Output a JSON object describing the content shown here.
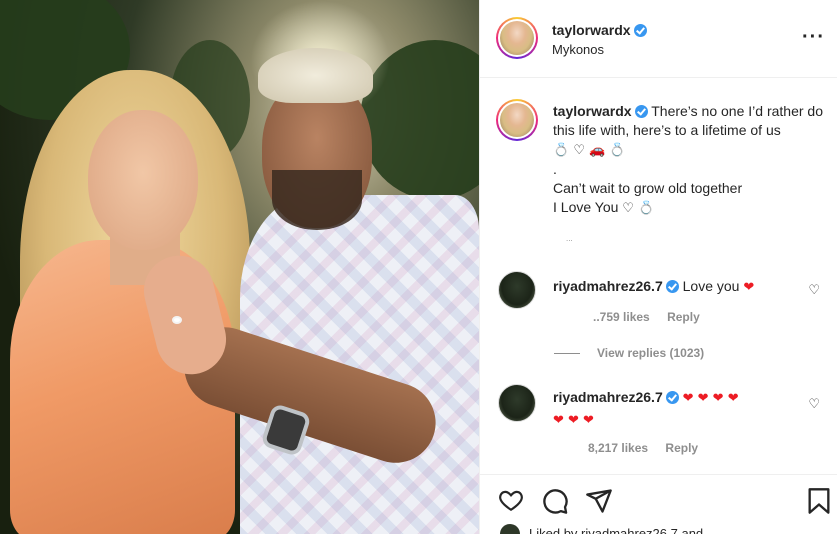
{
  "post": {
    "author": "taylorwardx",
    "location": "Mykonos",
    "caption_line1": "There’s no one I’d rather do this life with, here’s to a lifetime of us",
    "caption_emojis1": "💍 ♡ 🚗 💍",
    "caption_dot": ".",
    "caption_line2": "Can’t wait to grow old together",
    "caption_line3": "I Love You",
    "caption_emojis3": "♡ 💍",
    "caption_time": "..."
  },
  "comments": [
    {
      "user": "riyadmahrez26.7",
      "text": "Love you",
      "emoji": "❤",
      "likes": "..759 likes",
      "reply": "Reply"
    },
    {
      "user": "riyadmahrez26.7",
      "text": "",
      "emoji": "❤ ❤ ❤ ❤",
      "emoji2": "❤ ❤ ❤",
      "likes": "8,217 likes",
      "reply": "Reply"
    }
  ],
  "view_replies": "View replies (1023)",
  "liked_by": "Liked by riyadmahrez26.7 and",
  "icons": {
    "more": "more-options-icon",
    "heart": "heart-icon",
    "comment": "comment-icon",
    "share": "share-icon",
    "save": "bookmark-icon"
  },
  "colors": {
    "verified": "#3897f0",
    "heart": "#ed1c24",
    "muted": "#8e8e8e"
  }
}
